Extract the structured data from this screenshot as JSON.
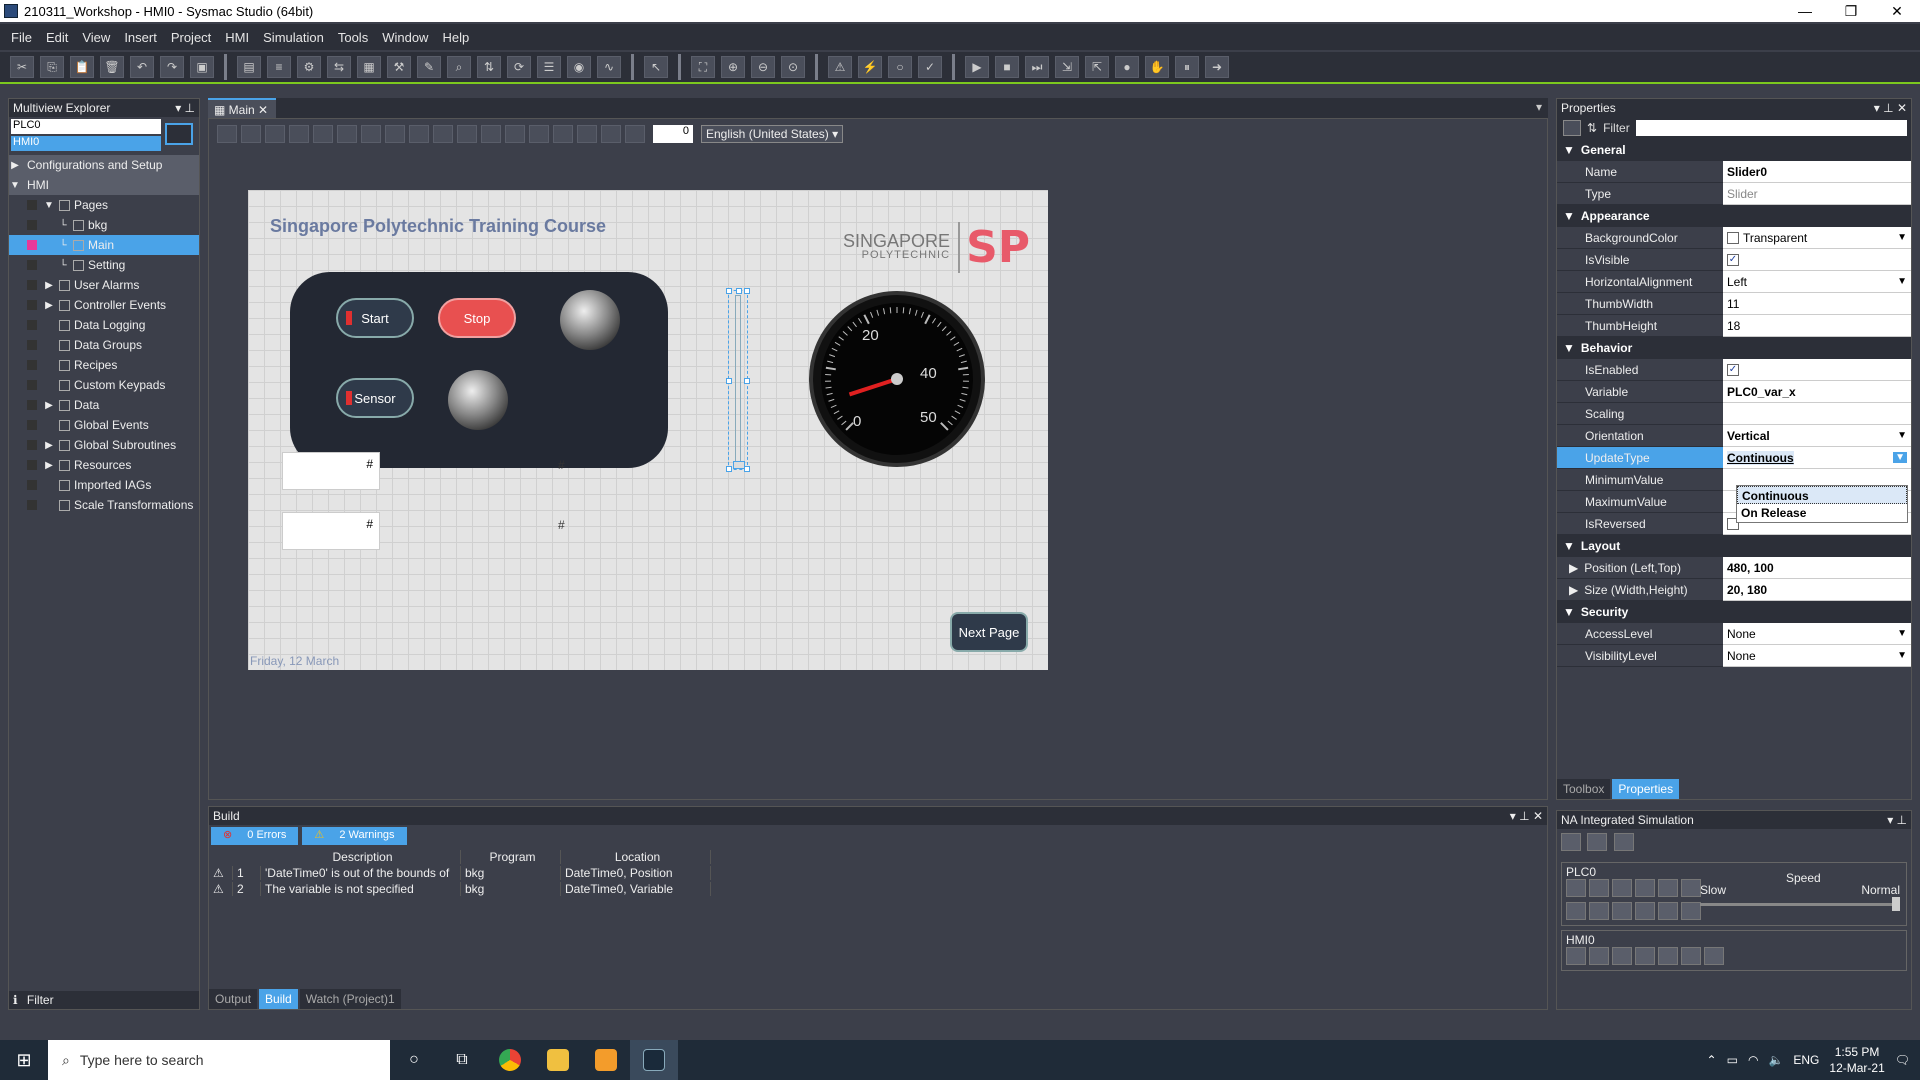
{
  "window": {
    "title": "210311_Workshop - HMI0 - Sysmac Studio (64bit)",
    "controls": [
      "—",
      "❐",
      "✕"
    ]
  },
  "menu": [
    "File",
    "Edit",
    "View",
    "Insert",
    "Project",
    "HMI",
    "Simulation",
    "Tools",
    "Window",
    "Help"
  ],
  "explorer": {
    "title": "Multiview Explorer",
    "devices": [
      "PLC0",
      "HMI0"
    ],
    "config_label": "Configurations and Setup",
    "hmi_label": "HMI",
    "items": [
      {
        "label": "Pages",
        "indent": 1,
        "expand": "▼"
      },
      {
        "label": "bkg",
        "indent": 2,
        "expand": ""
      },
      {
        "label": "Main",
        "indent": 2,
        "expand": "",
        "active": true
      },
      {
        "label": "Setting",
        "indent": 2,
        "expand": ""
      },
      {
        "label": "User Alarms",
        "indent": 1,
        "expand": "▶"
      },
      {
        "label": "Controller Events",
        "indent": 1,
        "expand": "▶"
      },
      {
        "label": "Data Logging",
        "indent": 1,
        "expand": ""
      },
      {
        "label": "Data Groups",
        "indent": 1,
        "expand": ""
      },
      {
        "label": "Recipes",
        "indent": 1,
        "expand": ""
      },
      {
        "label": "Custom Keypads",
        "indent": 1,
        "expand": ""
      },
      {
        "label": "Data",
        "indent": 1,
        "expand": "▶"
      },
      {
        "label": "Global Events",
        "indent": 1,
        "expand": ""
      },
      {
        "label": "Global Subroutines",
        "indent": 1,
        "expand": "▶"
      },
      {
        "label": "Resources",
        "indent": 1,
        "expand": "▶"
      },
      {
        "label": "Imported IAGs",
        "indent": 1,
        "expand": ""
      },
      {
        "label": "Scale Transformations",
        "indent": 1,
        "expand": ""
      }
    ],
    "filter_label": "Filter"
  },
  "editor": {
    "tab": "Main",
    "number": "0",
    "language": "English (United States)"
  },
  "canvas": {
    "title": "Singapore Polytechnic Training Course",
    "logo_line1": "SINGAPORE",
    "logo_line2": "POLYTECHNIC",
    "logo_mark": "SP",
    "start": "Start",
    "stop": "Stop",
    "sensor": "Sensor",
    "hash": "#",
    "next_page": "Next Page",
    "date": "Friday, 12 March",
    "gauge_labels": [
      "0",
      "20",
      "40",
      "50"
    ],
    "gauge_value_fraction": 0.1
  },
  "properties": {
    "title": "Properties",
    "filter_label": "Filter",
    "sections": {
      "general": "General",
      "appearance": "Appearance",
      "behavior": "Behavior",
      "layout": "Layout",
      "security": "Security"
    },
    "name_label": "Name",
    "name": "Slider0",
    "type_label": "Type",
    "type": "Slider",
    "bgcolor_label": "BackgroundColor",
    "bgcolor": "Transparent",
    "isvisible_label": "IsVisible",
    "isvisible": "✓",
    "halign_label": "HorizontalAlignment",
    "halign": "Left",
    "thumbw_label": "ThumbWidth",
    "thumbw": "11",
    "thumbh_label": "ThumbHeight",
    "thumbh": "18",
    "isenabled_label": "IsEnabled",
    "isenabled": "✓",
    "variable_label": "Variable",
    "variable": "PLC0_var_x",
    "scaling_label": "Scaling",
    "orientation_label": "Orientation",
    "orientation": "Vertical",
    "updatetype_label": "UpdateType",
    "updatetype": "Continuous",
    "updatetype_options": [
      "Continuous",
      "On Release"
    ],
    "minvalue_label": "MinimumValue",
    "maxvalue_label": "MaximumValue",
    "isreversed_label": "IsReversed",
    "position_label": "Position (Left,Top)",
    "position": "480, 100",
    "size_label": "Size (Width,Height)",
    "size": "20, 180",
    "access_label": "AccessLevel",
    "access": "None",
    "vislevel_label": "VisibilityLevel",
    "vislevel": "None",
    "tabs": [
      "Toolbox",
      "Properties"
    ]
  },
  "build": {
    "title": "Build",
    "errors": "0 Errors",
    "warnings": "2 Warnings",
    "headers": [
      "Description",
      "Program",
      "Location"
    ],
    "rows": [
      {
        "num": "1",
        "desc": "'DateTime0' is out of the bounds of",
        "program": "bkg",
        "location": "DateTime0, Position"
      },
      {
        "num": "2",
        "desc": "The variable is not specified",
        "program": "bkg",
        "location": "DateTime0, Variable"
      }
    ],
    "tabs": [
      "Output",
      "Build",
      "Watch (Project)1"
    ]
  },
  "simulation": {
    "title": "NA Integrated Simulation",
    "plc": "PLC0",
    "hmi": "HMI0",
    "speed": "Speed",
    "slow": "Slow",
    "normal": "Normal"
  },
  "taskbar": {
    "search_placeholder": "Type here to search",
    "lang": "ENG",
    "time": "1:55 PM",
    "date": "12-Mar-21"
  }
}
